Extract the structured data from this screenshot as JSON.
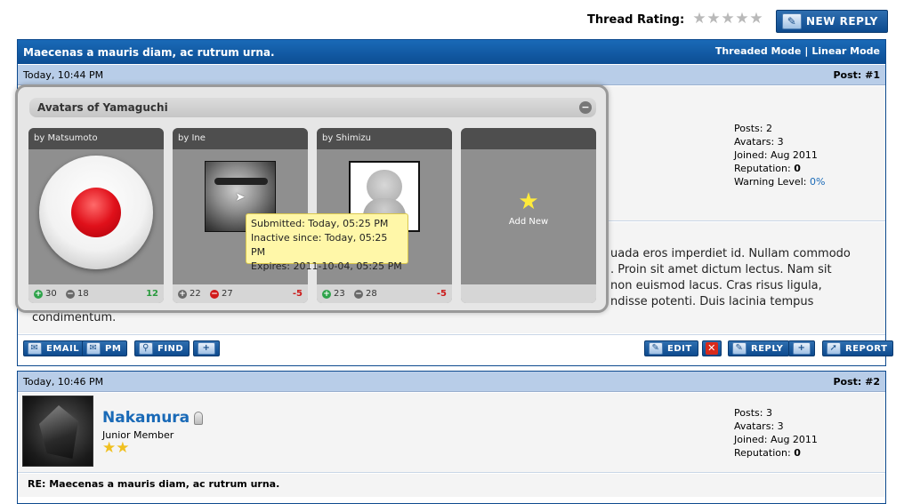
{
  "header": {
    "thread_rating_label": "Thread Rating:",
    "new_reply_label": "NEW REPLY"
  },
  "thread": {
    "title": "Maecenas a mauris diam, ac rutrum urna.",
    "modes": {
      "threaded": "Threaded Mode",
      "separator": "|",
      "linear": "Linear Mode"
    }
  },
  "post1": {
    "date": "Today, 10:44 PM",
    "number": "Post: #1",
    "stats": {
      "posts": "Posts: 2",
      "avatars": "Avatars: 3",
      "joined": "Joined: Aug 2011",
      "reputation_label": "Reputation:",
      "reputation_value": "0",
      "warning_label": "Warning Level:",
      "warning_value": "0%"
    },
    "text_lines": [
      "uada eros imperdiet id. Nullam commodo",
      ". Proin sit amet dictum lectus. Nam sit",
      "non euismod lacus. Cras risus ligula,",
      "ndisse potenti. Duis lacinia tempus"
    ],
    "text_last": "condimentum.",
    "buttons": {
      "email": "EMAIL",
      "pm": "PM",
      "find": "FIND",
      "edit": "EDIT",
      "reply": "REPLY",
      "report": "REPORT"
    }
  },
  "avatars_popup": {
    "title": "Avatars of Yamaguchi",
    "cards": [
      {
        "by": "by Matsumoto",
        "up": "30",
        "down": "18",
        "score": "12"
      },
      {
        "by": "by Ine",
        "up": "22",
        "down": "27",
        "score": "-5"
      },
      {
        "by": "by Shimizu",
        "up": "23",
        "down": "28",
        "score": "-5"
      }
    ],
    "add_new": "Add New",
    "tooltip": {
      "submitted": "Submitted: Today, 05:25 PM",
      "inactive": "Inactive since: Today, 05:25 PM",
      "expires": "Expires: 2011-10-04, 05:25 PM"
    }
  },
  "post2": {
    "date": "Today, 10:46 PM",
    "number": "Post: #2",
    "username": "Nakamura",
    "rank": "Junior Member",
    "stats": {
      "posts": "Posts: 3",
      "avatars": "Avatars: 3",
      "joined": "Joined: Aug 2011",
      "reputation_label": "Reputation:",
      "reputation_value": "0"
    },
    "subject": "RE: Maecenas a mauris diam, ac rutrum urna."
  }
}
